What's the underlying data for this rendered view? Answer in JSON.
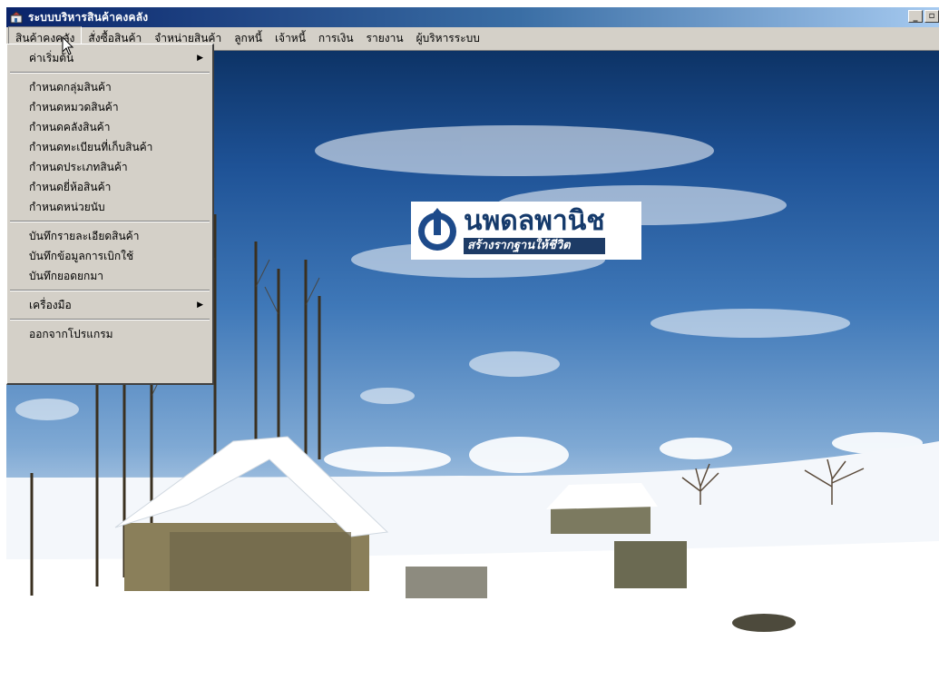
{
  "window": {
    "title": "ระบบบริหารสินค้าคงคลัง",
    "controls": {
      "minimize": "_",
      "restore": "▫"
    }
  },
  "menubar": {
    "items": [
      {
        "label": "สินค้าคงคลัง",
        "active": true
      },
      {
        "label": "สั่งซื้อสินค้า"
      },
      {
        "label": "จำหน่ายสินค้า"
      },
      {
        "label": "ลูกหนี้"
      },
      {
        "label": "เจ้าหนี้"
      },
      {
        "label": "การเงิน"
      },
      {
        "label": "รายงาน"
      },
      {
        "label": "ผู้บริหารระบบ"
      }
    ]
  },
  "dropdown": {
    "group1": {
      "defaults": "ค่าเริ่มต้น"
    },
    "group2": {
      "product_group": "กำหนดกลุ่มสินค้า",
      "product_category": "กำหนดหมวดสินค้า",
      "warehouse": "กำหนดคลังสินค้า",
      "storage_location": "กำหนดทะเบียนที่เก็บสินค้า",
      "product_type": "กำหนดประเภทสินค้า",
      "brand": "กำหนดยี่ห้อสินค้า",
      "unit": "กำหนดหน่วยนับ"
    },
    "group3": {
      "product_details": "บันทึกรายละเอียดสินค้า",
      "withdrawal": "บันทึกข้อมูลการเบิกใช้",
      "opening_balance": "บันทึกยอดยกมา"
    },
    "group4": {
      "tools": "เครื่องมือ"
    },
    "group5": {
      "exit": "ออกจากโปรแกรม"
    },
    "submenu_arrow": "▶"
  },
  "logo": {
    "name": "นพดลพานิช",
    "slogan": "สร้างรากฐานให้ชีวิต"
  },
  "colors": {
    "titlebar_start": "#0a246a",
    "titlebar_end": "#a6caf0",
    "menu_bg": "#d4d0c8",
    "logo_blue": "#153a6b"
  }
}
